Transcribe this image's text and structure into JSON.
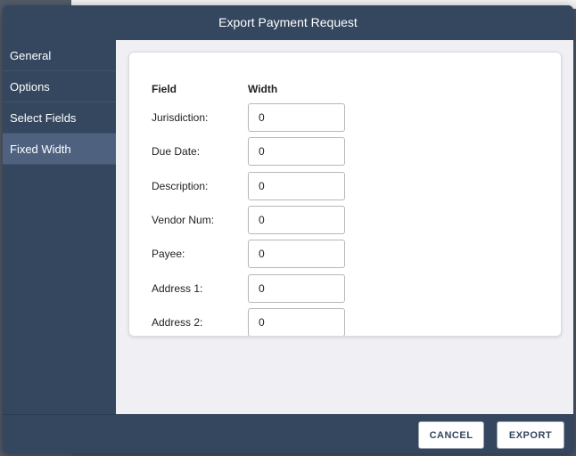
{
  "dialog": {
    "title": "Export Payment Request"
  },
  "sidebar": {
    "items": [
      {
        "label": "General",
        "active": false
      },
      {
        "label": "Options",
        "active": false
      },
      {
        "label": "Select Fields",
        "active": false
      },
      {
        "label": "Fixed Width",
        "active": true
      }
    ]
  },
  "fixed_width": {
    "field_header": "Field",
    "width_header": "Width",
    "rows": [
      {
        "label": "Jurisdiction:",
        "value": "0"
      },
      {
        "label": "Due Date:",
        "value": "0"
      },
      {
        "label": "Description:",
        "value": "0"
      },
      {
        "label": "Vendor Num:",
        "value": "0"
      },
      {
        "label": "Payee:",
        "value": "0"
      },
      {
        "label": "Address 1:",
        "value": "0"
      },
      {
        "label": "Address 2:",
        "value": "0"
      }
    ]
  },
  "footer": {
    "cancel_label": "CANCEL",
    "export_label": "EXPORT"
  }
}
